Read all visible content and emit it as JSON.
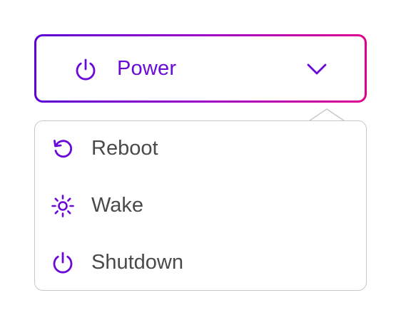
{
  "dropdown": {
    "label": "Power",
    "icon": "power-icon",
    "chevron_icon": "chevron-down-icon",
    "expanded": true
  },
  "menu": {
    "items": [
      {
        "label": "Reboot",
        "icon": "reboot-icon"
      },
      {
        "label": "Wake",
        "icon": "sun-icon"
      },
      {
        "label": "Shutdown",
        "icon": "power-icon"
      }
    ]
  },
  "colors": {
    "accent": "#6a0ad8",
    "gradient_start": "#5a00d6",
    "gradient_end": "#e0008f",
    "item_text": "#4a4a4a",
    "menu_border": "#c8c8c8"
  }
}
